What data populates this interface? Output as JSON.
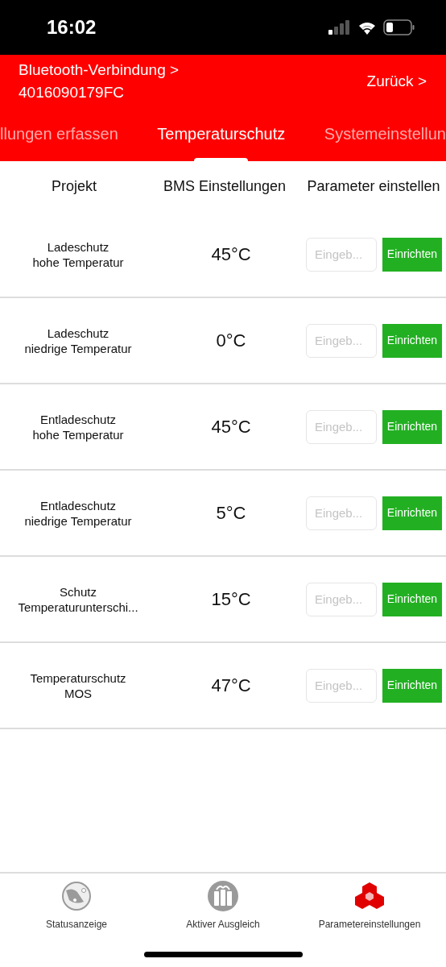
{
  "status_bar": {
    "time": "16:02"
  },
  "header": {
    "connection": "Bluetooth-Verbindung >",
    "device": "4016090179FC",
    "back": "Zurück >"
  },
  "tabs": [
    {
      "label": "llungen erfassen",
      "selected": false
    },
    {
      "label": "Temperaturschutz",
      "selected": true
    },
    {
      "label": "Systemeinstellun",
      "selected": false
    }
  ],
  "table": {
    "columns": [
      "Projekt",
      "BMS Einstellungen",
      "Parameter einstellen"
    ],
    "rows": [
      {
        "name": [
          "Ladeschutz",
          "hohe Temperatur"
        ],
        "value": "45°C",
        "placeholder": "Eingeb...",
        "button": "Einrichten"
      },
      {
        "name": [
          "Ladeschutz",
          "niedrige Temperatur"
        ],
        "value": "0°C",
        "placeholder": "Eingeb...",
        "button": "Einrichten"
      },
      {
        "name": [
          "Entladeschutz",
          "hohe Temperatur"
        ],
        "value": "45°C",
        "placeholder": "Eingeb...",
        "button": "Einrichten"
      },
      {
        "name": [
          "Entladeschutz",
          "niedrige Temperatur"
        ],
        "value": "5°C",
        "placeholder": "Eingeb...",
        "button": "Einrichten"
      },
      {
        "name": [
          "Schutz",
          "Temperaturunterschi..."
        ],
        "value": "15°C",
        "placeholder": "Eingeb...",
        "button": "Einrichten"
      },
      {
        "name": [
          "Temperaturschutz",
          "MOS"
        ],
        "value": "47°C",
        "placeholder": "Eingeb...",
        "button": "Einrichten"
      }
    ]
  },
  "bottom_nav": [
    {
      "kind": "globe",
      "label": "Statusanzeige",
      "selected": false
    },
    {
      "kind": "cells",
      "label": "Aktiver Ausgleich",
      "selected": false
    },
    {
      "kind": "cubes",
      "label": "Parametereinstellungen",
      "selected": true
    }
  ]
}
